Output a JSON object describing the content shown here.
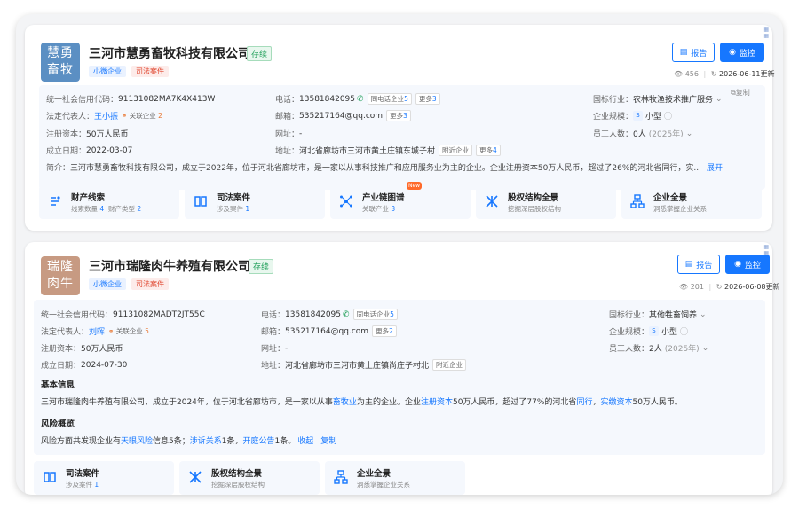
{
  "companies": [
    {
      "logo_text": [
        "慧勇",
        "畜牧"
      ],
      "logo_color": "#5b8fc3",
      "name": "三河市慧勇畜牧科技有限公司",
      "status": "存续",
      "tags": [
        "小微企业",
        "司法案件"
      ],
      "report_label": "报告",
      "monitor_label": "监控",
      "views": "456",
      "update_date": "2026-06-11更新",
      "copy_label": "复制",
      "credit_code_label": "统一社会信用代码：",
      "credit_code": "91131082MA7K4X413W",
      "legal_rep_label": "法定代表人：",
      "legal_rep": "王小振",
      "legal_rep_related_label": "关联企业",
      "legal_rep_related_count": "2",
      "capital_label": "注册资本：",
      "capital": "50万人民币",
      "found_label": "成立日期：",
      "found_date": "2022-03-07",
      "phone_label": "电话：",
      "phone": "13581842095",
      "same_phone_label": "同电话企业",
      "same_phone_count": "5",
      "phone_more_label": "更多",
      "phone_more_count": "3",
      "email_label": "邮箱：",
      "email": "535217164@qq.com",
      "email_more_label": "更多",
      "email_more_count": "3",
      "website_label": "网址：",
      "website": "-",
      "address_label": "地址：",
      "address": "河北省廊坊市三河市黄土庄镇东城子村",
      "nearby_label": "附近企业",
      "addr_more_label": "更多",
      "addr_more_count": "4",
      "industry_label": "国标行业：",
      "industry": "农林牧渔技术推广服务",
      "scale_label": "企业规模：",
      "scale_badge": "S",
      "scale": "小型",
      "staff_label": "员工人数：",
      "staff": "0人",
      "staff_year": "(2025年)",
      "intro_label": "简介：",
      "intro": "三河市慧勇畜牧科技有限公司，成立于2022年，位于河北省廊坊市，是一家以从事科技推广和应用服务业为主的企业。企业注册资本50万人民币，超过了26%的河北省同行，实...",
      "expand_label": "展开",
      "features": [
        {
          "title": "财产线索",
          "sub": "线索数量",
          "n1": "4",
          "sub2": "财产类型",
          "n2": "2"
        },
        {
          "title": "司法案件",
          "sub": "涉及案件",
          "n1": "1",
          "sub2": "",
          "n2": ""
        },
        {
          "title": "产业链图谱",
          "sub": "关联产业",
          "n1": "3",
          "sub2": "",
          "n2": "",
          "badge": "New"
        },
        {
          "title": "股权结构全景",
          "sub": "挖掘深层股权结构",
          "n1": "",
          "sub2": "",
          "n2": ""
        },
        {
          "title": "企业全景",
          "sub": "洞悉掌握企业关系",
          "n1": "",
          "sub2": "",
          "n2": ""
        }
      ]
    },
    {
      "logo_text": [
        "瑞隆",
        "肉牛"
      ],
      "logo_color": "#c79a82",
      "name": "三河市瑞隆肉牛养殖有限公司",
      "status": "存续",
      "tags": [
        "小微企业",
        "司法案件"
      ],
      "report_label": "报告",
      "monitor_label": "监控",
      "views": "201",
      "update_date": "2026-06-08更新",
      "credit_code_label": "统一社会信用代码：",
      "credit_code": "91131082MADT2JT55C",
      "legal_rep_label": "法定代表人：",
      "legal_rep": "刘晖",
      "legal_rep_related_label": "关联企业",
      "legal_rep_related_count": "5",
      "capital_label": "注册资本：",
      "capital": "50万人民币",
      "found_label": "成立日期：",
      "found_date": "2024-07-30",
      "phone_label": "电话：",
      "phone": "13581842095",
      "same_phone_label": "同电话企业",
      "same_phone_count": "5",
      "email_label": "邮箱：",
      "email": "535217164@qq.com",
      "email_more_label": "更多",
      "email_more_count": "2",
      "website_label": "网址：",
      "website": "-",
      "address_label": "地址：",
      "address": "河北省廊坊市三河市黄土庄镇尚庄子村北",
      "nearby_label": "附近企业",
      "industry_label": "国标行业：",
      "industry": "其他牲畜饲养",
      "scale_label": "企业规模：",
      "scale_badge": "S",
      "scale": "小型",
      "staff_label": "员工人数：",
      "staff": "2人",
      "staff_year": "(2025年)",
      "basic_title": "基本信息",
      "basic_parts": [
        "三河市瑞隆肉牛养殖有限公司，成立于2024年，位于河北省廊坊市，是一家以从事",
        "畜牧业",
        "为主的企业。企业",
        "注册资本",
        "50万人民币，超过了77%的河北省",
        "同行",
        "，",
        "实缴资本",
        "50万人民币。"
      ],
      "risk_title": "风险概览",
      "risk_parts": [
        "风险方面共发现企业有",
        "天眼风险",
        "信息5条；",
        "涉诉关系",
        "1条，",
        "开庭公告",
        "1条。",
        "收起",
        "复制"
      ],
      "features": [
        {
          "title": "司法案件",
          "sub": "涉及案件",
          "n1": "1"
        },
        {
          "title": "股权结构全景",
          "sub": "挖掘深层股权结构",
          "n1": ""
        },
        {
          "title": "企业全景",
          "sub": "洞悉掌握企业关系",
          "n1": ""
        }
      ]
    }
  ]
}
